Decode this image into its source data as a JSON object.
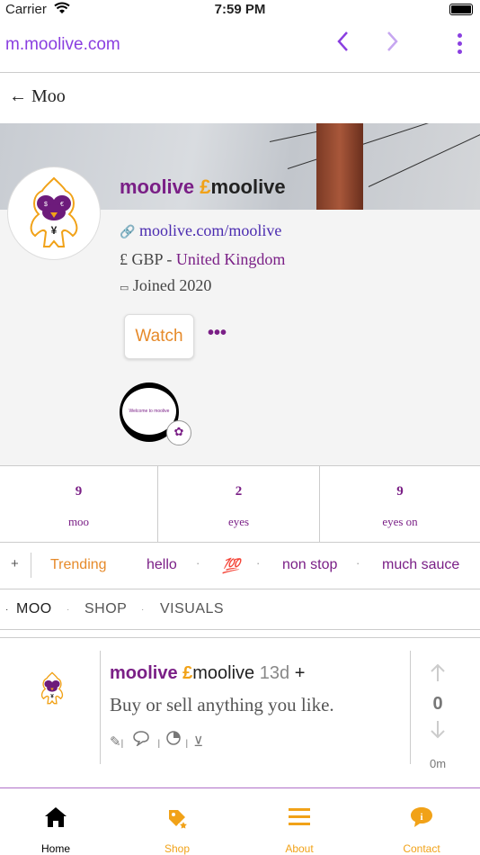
{
  "status_bar": {
    "carrier": "Carrier",
    "time": "7:59 PM"
  },
  "browser": {
    "url": "m.moolive.com"
  },
  "back": {
    "label": "← Moo"
  },
  "profile": {
    "name": "moolive",
    "currency_symbol": "£",
    "handle": "moolive",
    "link": "moolive.com/moolive",
    "currency_prefix": "£ GBP - ",
    "country": "United Kingdom",
    "joined": "Joined 2020",
    "watch_label": "Watch",
    "more_label": "•••",
    "story_text": "Welcome to moolive"
  },
  "stats": [
    {
      "value": "9",
      "label": "moo"
    },
    {
      "value": "2",
      "label": "eyes"
    },
    {
      "value": "9",
      "label": "eyes on"
    }
  ],
  "tags": {
    "plus": "+",
    "items": [
      "Trending",
      "hello",
      "💯",
      "non stop",
      "much sauce"
    ],
    "separator": "·"
  },
  "tabs": [
    "MOO",
    "SHOP",
    "VISUALS"
  ],
  "post": {
    "name": "moolive",
    "currency_symbol": "£",
    "handle": "moolive",
    "age": "13d",
    "plus": "+",
    "text": "Buy or sell anything you like.",
    "votes": "0",
    "time": "0m"
  },
  "nav": [
    {
      "label": "Home",
      "icon": "home-icon"
    },
    {
      "label": "Shop",
      "icon": "shop-icon"
    },
    {
      "label": "About",
      "icon": "menu-icon"
    },
    {
      "label": "Contact",
      "icon": "info-icon"
    }
  ],
  "colors": {
    "brand_purple": "#7a1f86",
    "accent_orange": "#f1a218",
    "browser_purple": "#8a3fe0"
  }
}
